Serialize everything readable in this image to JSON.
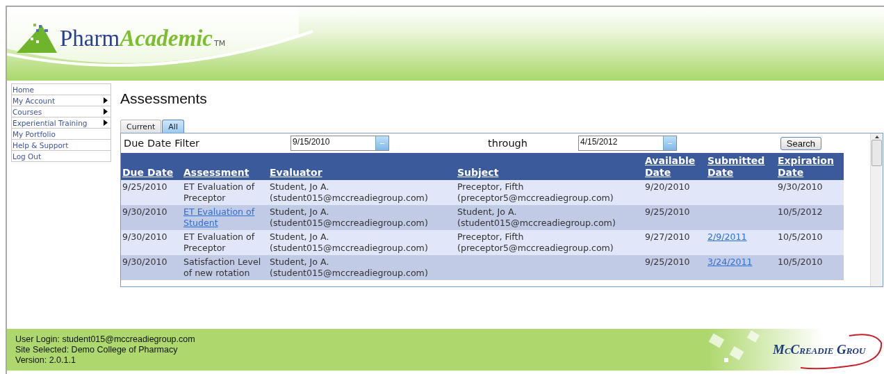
{
  "logo": {
    "first": "Pharm",
    "second": "Academic",
    "mark": "TM"
  },
  "sidebar": {
    "items": [
      {
        "label": "Home",
        "submenu": false
      },
      {
        "label": "My Account",
        "submenu": true
      },
      {
        "label": "Courses",
        "submenu": true
      },
      {
        "label": "Experiential Training",
        "submenu": true
      },
      {
        "label": "My Portfolio",
        "submenu": false
      },
      {
        "label": "Help & Support",
        "submenu": false
      },
      {
        "label": "Log Out",
        "submenu": false
      }
    ]
  },
  "page_title": "Assessments",
  "tabs": [
    {
      "label": "Current",
      "selected": false
    },
    {
      "label": "All",
      "selected": true
    }
  ],
  "filter": {
    "label": "Due Date Filter",
    "from": "9/15/2010",
    "through_label": "through",
    "to": "4/15/2012",
    "button": "Search"
  },
  "table": {
    "columns": [
      "Due Date",
      "Assessment",
      "Evaluator",
      "Subject",
      "Available Date",
      "Submitted Date",
      "Expiration Date"
    ],
    "rows": [
      {
        "cells": [
          {
            "text": "9/25/2010",
            "link": false
          },
          {
            "text": "ET Evaluation of Preceptor",
            "link": false
          },
          {
            "text": "Student, Jo A. (student015@mccreadiegroup.com)",
            "link": false
          },
          {
            "text": "Preceptor, Fifth (preceptor5@mccreadiegroup.com)",
            "link": false
          },
          {
            "text": "9/20/2010",
            "link": false
          },
          {
            "text": ""
          },
          {
            "text": "9/30/2010",
            "link": false
          }
        ]
      },
      {
        "cells": [
          {
            "text": "9/30/2010",
            "link": false
          },
          {
            "text": "ET Evaluation of Student",
            "link": true
          },
          {
            "text": "Student, Jo A. (student015@mccreadiegroup.com)",
            "link": false
          },
          {
            "text": "Student, Jo A. (student015@mccreadiegroup.com)",
            "link": false
          },
          {
            "text": "9/25/2010",
            "link": false
          },
          {
            "text": ""
          },
          {
            "text": "10/5/2012",
            "link": false
          }
        ]
      },
      {
        "cells": [
          {
            "text": "9/30/2010",
            "link": false
          },
          {
            "text": "ET Evaluation of Preceptor",
            "link": false
          },
          {
            "text": "Student, Jo A. (student015@mccreadiegroup.com)",
            "link": false
          },
          {
            "text": "Preceptor, Fifth (preceptor5@mccreadiegroup.com)",
            "link": false
          },
          {
            "text": "9/27/2010",
            "link": false
          },
          {
            "text": "2/9/2011",
            "link": true
          },
          {
            "text": "10/5/2010",
            "link": false
          }
        ]
      },
      {
        "cells": [
          {
            "text": "9/30/2010",
            "link": false
          },
          {
            "text": "Satisfaction Level of new rotation",
            "link": false
          },
          {
            "text": "Student, Jo A. (student015@mccreadiegroup.com)",
            "link": false
          },
          {
            "text": ""
          },
          {
            "text": "9/25/2010",
            "link": false
          },
          {
            "text": "3/24/2011",
            "link": true
          },
          {
            "text": "10/5/2010",
            "link": false
          }
        ]
      }
    ]
  },
  "footer": {
    "lines": [
      "User Login: student015@mccreadiegroup.com",
      "Site Selected: Demo College of Pharmacy",
      "Version: 2.0.1.1"
    ],
    "brand": "McCreadie Grou"
  }
}
